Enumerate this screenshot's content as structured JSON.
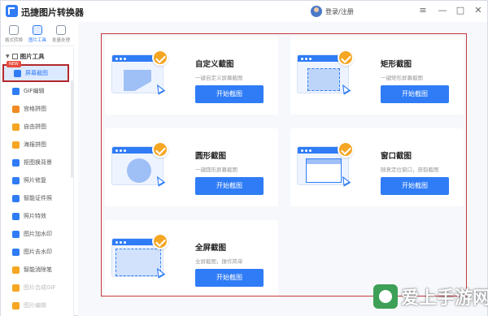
{
  "app": {
    "title": "迅捷图片转换器",
    "user_label": "登录/注册",
    "win_menu": "≡",
    "win_min": "—",
    "win_max": "□",
    "win_close": "✕"
  },
  "top_nav": [
    {
      "label": "格式转换",
      "active": false
    },
    {
      "label": "图片工具",
      "active": true
    },
    {
      "label": "批量处理",
      "active": false
    }
  ],
  "sidebar": {
    "section_title": "图片工具",
    "new_badge": "NEW",
    "items": [
      {
        "label": "屏幕截图",
        "color": "#2f7cf6",
        "active": true
      },
      {
        "label": "GIF编辑",
        "color": "#2f7cf6"
      },
      {
        "label": "宫格拼图",
        "color": "#f08a24"
      },
      {
        "label": "自由拼图",
        "color": "#f5a623"
      },
      {
        "label": "海报拼图",
        "color": "#f5a623"
      },
      {
        "label": "抠图换背景",
        "color": "#2f7cf6"
      },
      {
        "label": "照片修复",
        "color": "#2f7cf6"
      },
      {
        "label": "智能证件照",
        "color": "#2f7cf6"
      },
      {
        "label": "照片特效",
        "color": "#2f7cf6"
      },
      {
        "label": "图片加水印",
        "color": "#2f7cf6"
      },
      {
        "label": "图片去水印",
        "color": "#2f7cf6"
      },
      {
        "label": "智能消除笔",
        "color": "#f5a623"
      },
      {
        "label": "图片合成GIF",
        "color": "#f5a623",
        "faded": true
      },
      {
        "label": "图片编辑",
        "color": "#f5a623",
        "faded": true
      }
    ]
  },
  "cards": [
    {
      "title": "自定义截图",
      "desc": "一键自定义屏幕截图",
      "button": "开始截图"
    },
    {
      "title": "矩形截图",
      "desc": "一键矩形屏幕截图",
      "button": "开始截图"
    },
    {
      "title": "圆形截图",
      "desc": "一键圆形屏幕截图",
      "button": "开始截图"
    },
    {
      "title": "窗口截图",
      "desc": "随意定位窗口，获取截图",
      "button": "开始截图"
    },
    {
      "title": "全屏截图",
      "desc": "全屏截图，操作简单",
      "button": "开始截图"
    }
  ],
  "watermark": "爱上手游网",
  "colors": {
    "accent": "#2f7cf6",
    "check": "#f5a623",
    "highlight_frame": "#c6383a"
  }
}
